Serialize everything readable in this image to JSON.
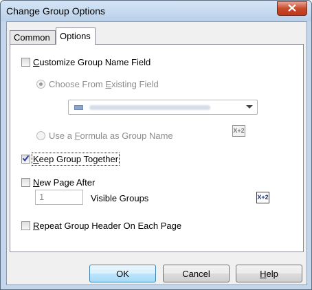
{
  "window": {
    "title": "Change Group Options"
  },
  "tabs": [
    {
      "label": "Common",
      "selected": false
    },
    {
      "label": "Options",
      "selected": true
    }
  ],
  "options": {
    "customize_label_pre": "",
    "customize_label_u": "C",
    "customize_label_post": "ustomize Group Name Field",
    "customize_checked": false,
    "choose_existing_pre": "Choose From ",
    "choose_existing_u": "E",
    "choose_existing_post": "xisting Field",
    "use_formula_pre": "Use a ",
    "use_formula_u": "F",
    "use_formula_post": "ormula as Group Name",
    "keep_together_u": "K",
    "keep_together_post": "eep Group Together",
    "keep_together_checked": true,
    "new_page_u": "N",
    "new_page_post": "ew Page After",
    "new_page_checked": false,
    "visible_groups_value": "1",
    "visible_groups_label": "Visible Groups",
    "repeat_header_u": "R",
    "repeat_header_post": "epeat Group Header On Each Page",
    "repeat_header_checked": false,
    "formula_button_label": "X+2"
  },
  "buttons": {
    "ok": "OK",
    "cancel": "Cancel",
    "help_u": "H",
    "help_post": "elp"
  },
  "icons": {
    "close": "close-icon",
    "check": "check-icon",
    "dropdown": "chevron-down-icon",
    "formula": "formula-icon"
  },
  "colors": {
    "title_bar": "#b9d0ea",
    "close_button": "#c74a2b",
    "checkmark": "#2a3f9b",
    "default_button": "#bee6fd"
  }
}
